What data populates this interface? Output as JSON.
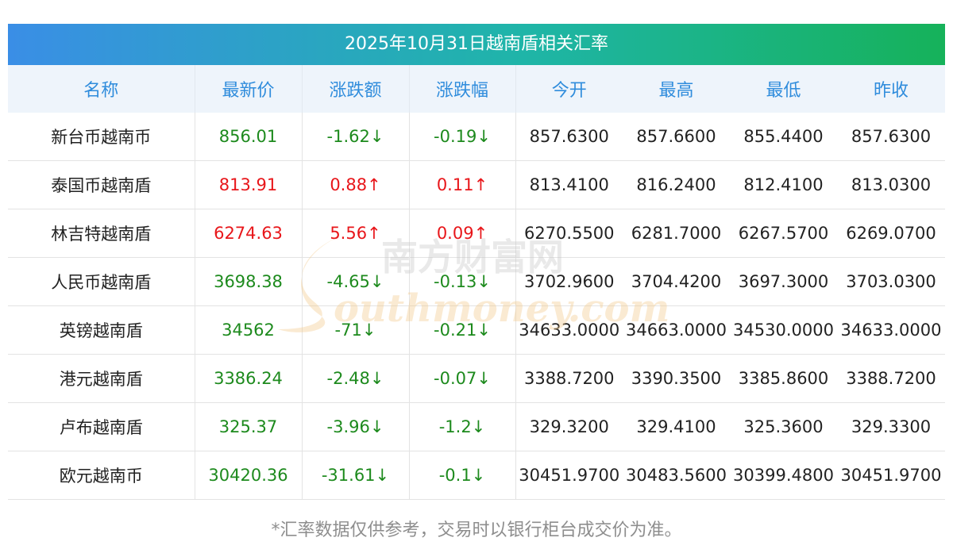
{
  "title": "2025年10月31日越南盾相关汇率",
  "headers": [
    "名称",
    "最新价",
    "涨跌额",
    "涨跌幅",
    "今开",
    "最高",
    "最低",
    "昨收"
  ],
  "rows": [
    {
      "name": "新台币越南币",
      "latest": "856.01",
      "change": "-1.62↓",
      "pct": "-0.19↓",
      "open": "857.6300",
      "high": "857.6600",
      "low": "855.4400",
      "prev": "857.6300",
      "dir": "down"
    },
    {
      "name": "泰国币越南盾",
      "latest": "813.91",
      "change": "0.88↑",
      "pct": "0.11↑",
      "open": "813.4100",
      "high": "816.2400",
      "low": "812.4100",
      "prev": "813.0300",
      "dir": "up"
    },
    {
      "name": "林吉特越南盾",
      "latest": "6274.63",
      "change": "5.56↑",
      "pct": "0.09↑",
      "open": "6270.5500",
      "high": "6281.7000",
      "low": "6267.5700",
      "prev": "6269.0700",
      "dir": "up"
    },
    {
      "name": "人民币越南盾",
      "latest": "3698.38",
      "change": "-4.65↓",
      "pct": "-0.13↓",
      "open": "3702.9600",
      "high": "3704.4200",
      "low": "3697.3000",
      "prev": "3703.0300",
      "dir": "down"
    },
    {
      "name": "英镑越南盾",
      "latest": "34562",
      "change": "-71↓",
      "pct": "-0.21↓",
      "open": "34633.0000",
      "high": "34663.0000",
      "low": "34530.0000",
      "prev": "34633.0000",
      "dir": "down"
    },
    {
      "name": "港元越南盾",
      "latest": "3386.24",
      "change": "-2.48↓",
      "pct": "-0.07↓",
      "open": "3388.7200",
      "high": "3390.3500",
      "low": "3385.8600",
      "prev": "3388.7200",
      "dir": "down"
    },
    {
      "name": "卢布越南盾",
      "latest": "325.37",
      "change": "-3.96↓",
      "pct": "-1.2↓",
      "open": "329.3200",
      "high": "329.4100",
      "low": "325.3600",
      "prev": "329.3300",
      "dir": "down"
    },
    {
      "name": "欧元越南币",
      "latest": "30420.36",
      "change": "-31.61↓",
      "pct": "-0.1↓",
      "open": "30451.9700",
      "high": "30483.5600",
      "low": "30399.4800",
      "prev": "30451.9700",
      "dir": "down"
    }
  ],
  "footnote": "*汇率数据仅供参考，交易时以银行柜台成交价为准。",
  "watermark": {
    "cn": "南方财富网",
    "en": "outhmoney.com"
  },
  "colors": {
    "up": "#e8161a",
    "down": "#1d8a1d",
    "header_text": "#2f8cdc",
    "header_bg": "#eef4fb"
  }
}
